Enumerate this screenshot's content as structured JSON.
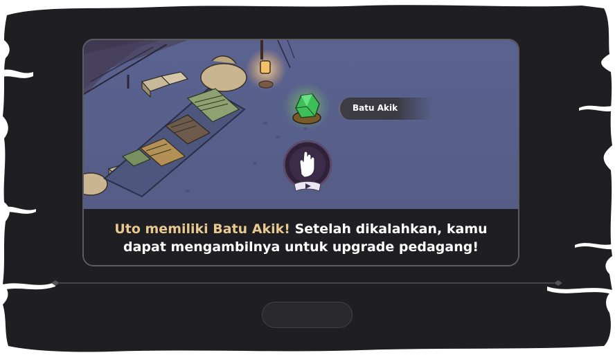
{
  "item": {
    "label": "Batu Akik",
    "icon": "green-gem-icon"
  },
  "tutorial": {
    "highlight": "Uto memiliki Batu Akik!",
    "line1_rest": " Setelah dikalahkan, kamu",
    "line2": "dapat mengambilnya  untuk upgrade pedagang!",
    "hand_icon": "tap-hand-icon"
  },
  "colors": {
    "frame": "#1f1e22",
    "panel_caption": "#1f1e22",
    "highlight_text": "#e8c98f",
    "gem": "#4fd06b",
    "hand_circle": "#3a2a4a",
    "snow": "#59628d"
  }
}
